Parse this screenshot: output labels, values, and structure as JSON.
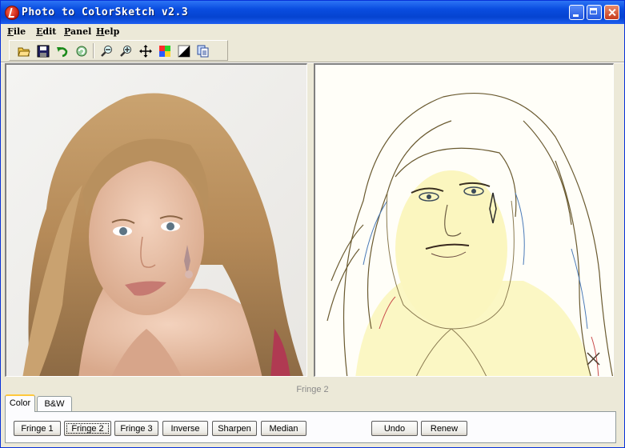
{
  "window": {
    "title": "Photo to ColorSketch v2.3",
    "icon": "app-logo-icon",
    "controls": [
      "minimize-icon",
      "maximize-icon",
      "close-icon"
    ]
  },
  "menu": {
    "items": [
      {
        "label": "File",
        "accel": "F",
        "rest": "ile"
      },
      {
        "label": "Edit",
        "accel": "E",
        "rest": "dit"
      },
      {
        "label": "Panel",
        "accel": "P",
        "rest": "anel"
      },
      {
        "label": "Help",
        "accel": "H",
        "rest": "elp"
      }
    ]
  },
  "toolbar": {
    "tools": [
      {
        "name": "open-folder-icon"
      },
      {
        "name": "save-disk-icon"
      },
      {
        "name": "undo-arrow-icon"
      },
      {
        "name": "refresh-icon"
      },
      {
        "name": "zoom-out-icon"
      },
      {
        "name": "zoom-in-icon"
      },
      {
        "name": "move-pan-icon"
      },
      {
        "name": "color-palette-icon"
      },
      {
        "name": "black-white-icon"
      },
      {
        "name": "copy-pages-icon"
      }
    ]
  },
  "status": {
    "current_effect": "Fringe 2"
  },
  "tabs": [
    {
      "label": "Color",
      "active": true
    },
    {
      "label": "B&W",
      "active": false
    }
  ],
  "effects": {
    "buttons": [
      {
        "label": "Fringe 1"
      },
      {
        "label": "Fringe 2",
        "focused": true
      },
      {
        "label": "Fringe 3"
      },
      {
        "label": "Inverse"
      },
      {
        "label": "Sharpen"
      },
      {
        "label": "Median"
      }
    ],
    "undo_label": "Undo",
    "renew_label": "Renew"
  },
  "colors": {
    "title_bar": "#0a4de0",
    "face_bg": "#ece9d8",
    "sketch_tint": "#fbf7c4",
    "active_tab": "#ffc83c"
  }
}
